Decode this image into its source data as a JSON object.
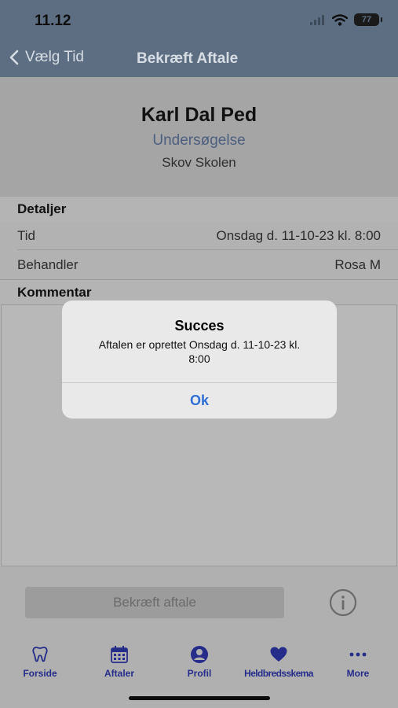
{
  "status_bar": {
    "time": "11.12",
    "battery": "77",
    "signal_icon": "cellular-signal-icon",
    "wifi_icon": "wifi-icon"
  },
  "nav": {
    "back_label": "Vælg Tid",
    "title": "Bekræft Aftale"
  },
  "appointment": {
    "name": "Karl Dal  Ped",
    "treatment": "Undersøgelse",
    "clinic": "Skov Skolen"
  },
  "details": {
    "heading": "Detaljer",
    "rows": [
      {
        "label": "Tid",
        "value": "Onsdag d. 11-10-23 kl. 8:00"
      },
      {
        "label": "Behandler",
        "value": "Rosa M"
      }
    ]
  },
  "comment": {
    "heading": "Kommentar"
  },
  "confirm_button": {
    "label": "Bekræft aftale"
  },
  "tabs": [
    {
      "label": "Forside",
      "icon": "tooth-icon"
    },
    {
      "label": "Aftaler",
      "icon": "calendar-icon"
    },
    {
      "label": "Profil",
      "icon": "profile-icon"
    },
    {
      "label": "Heldbredsskema",
      "icon": "heart-icon"
    },
    {
      "label": "More",
      "icon": "more-dots-icon"
    }
  ],
  "dialog": {
    "title": "Succes",
    "message": "Aftalen er oprettet Onsdag d. 11-10-23 kl. 8:00",
    "ok_label": "Ok"
  },
  "colors": {
    "tab_accent": "#262c8a",
    "dialog_button": "#2f6fd6",
    "header_bar": "#5d6e83"
  }
}
